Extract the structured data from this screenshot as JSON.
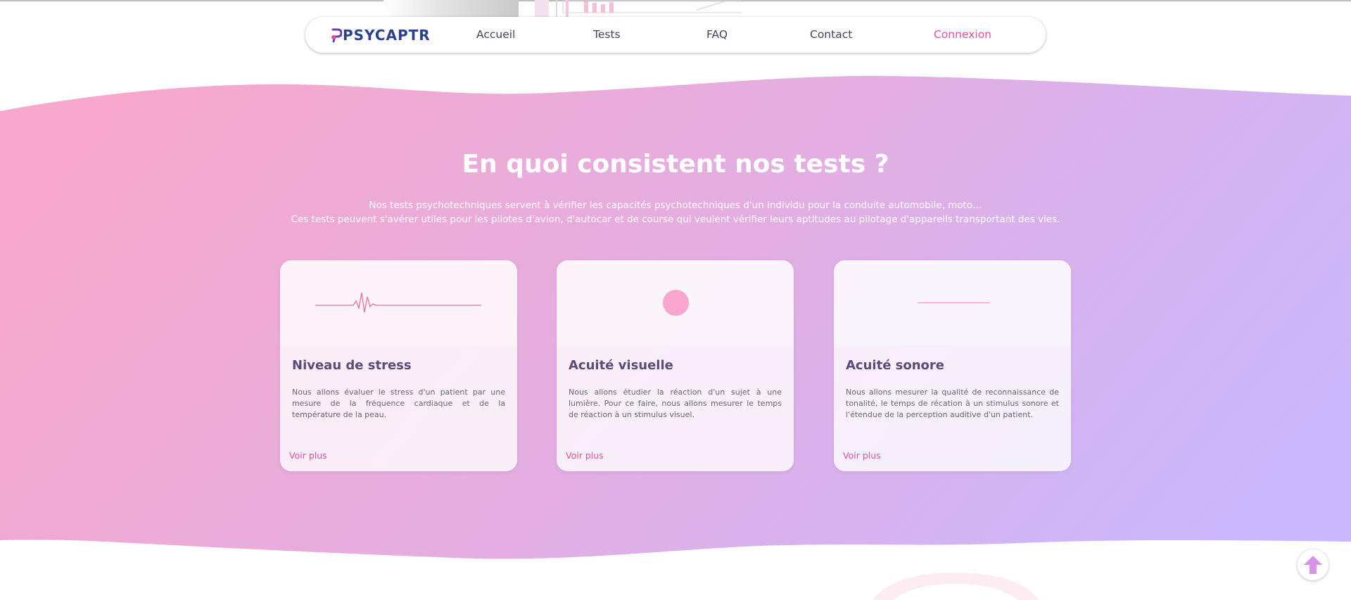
{
  "nav": {
    "brand": "PSYCAPTR",
    "links": [
      "Accueil",
      "Tests",
      "FAQ",
      "Contact"
    ],
    "login": "Connexion"
  },
  "section": {
    "title": "En quoi consistent nos tests ?",
    "lines": [
      "Nos tests psychotechniques servent à vérifier les capacités psychotechniques d'un individu pour la conduite automobile, moto…",
      "Ces tests peuvent s'avérer utiles pour les pilotes d'avion, d'autocar et de course qui veulent vérifier leurs aptitudes au pilotage d'appareils transportant des vies."
    ]
  },
  "cards": [
    {
      "title": "Niveau de stress",
      "text": "Nous allons évaluer le stress d'un patient par une mesure de la fréquence cardiaque et de la température de la peau.",
      "link": "Voir plus",
      "icon": "heartbeat-line"
    },
    {
      "title": "Acuité visuelle",
      "text": "Nous allons étudier la réaction d'un sujet à une lumière. Pour ce faire, nous allons mesurer le temps de réaction à un stimulus visuel.",
      "link": "Voir plus",
      "icon": "light-dot"
    },
    {
      "title": "Acuité sonore",
      "text": "Nous allons mesurer la qualité de reconnaissance de tonalité, le temps de récation à un stimulus sonore et l'étendue de la perception auditive d'un patient.",
      "link": "Voir plus",
      "icon": "sound-line"
    }
  ],
  "colors": {
    "accent": "#ea4f98",
    "brand": "#2a3f8f",
    "gradient_start": "#f7a8cb",
    "gradient_end": "#c9b8fc"
  },
  "scroll_top_icon": "arrow-up-icon"
}
